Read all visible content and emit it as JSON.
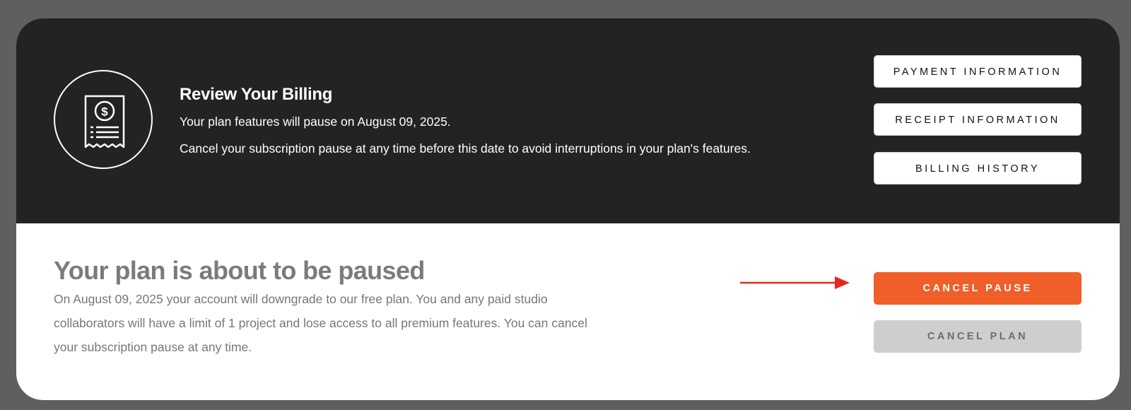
{
  "billing": {
    "title": "Review Your Billing",
    "pause_date_line": "Your plan features will pause on August 09, 2025.",
    "cancel_hint": "Cancel your subscription pause at any time before this date to avoid interruptions in your plan's features.",
    "icon": "receipt-dollar-icon"
  },
  "buttons": {
    "payment_information": "PAYMENT INFORMATION",
    "receipt_information": "RECEIPT INFORMATION",
    "billing_history": "BILLING HISTORY",
    "cancel_pause": "CANCEL PAUSE",
    "cancel_plan": "CANCEL PLAN"
  },
  "pause_notice": {
    "title": "Your plan is about to be paused",
    "description": "On August 09, 2025 your account will downgrade to our free plan. You and any paid studio collaborators will have a limit of 1 project and lose access to all premium features. You can cancel your subscription pause at any time."
  },
  "annotation": {
    "icon": "arrow-right-icon"
  },
  "colors": {
    "page_background": "#5f5f5f",
    "header_background": "#232323",
    "accent": "#f05e2a",
    "annotation_arrow": "#e8261c",
    "disabled_button": "#cecece"
  }
}
